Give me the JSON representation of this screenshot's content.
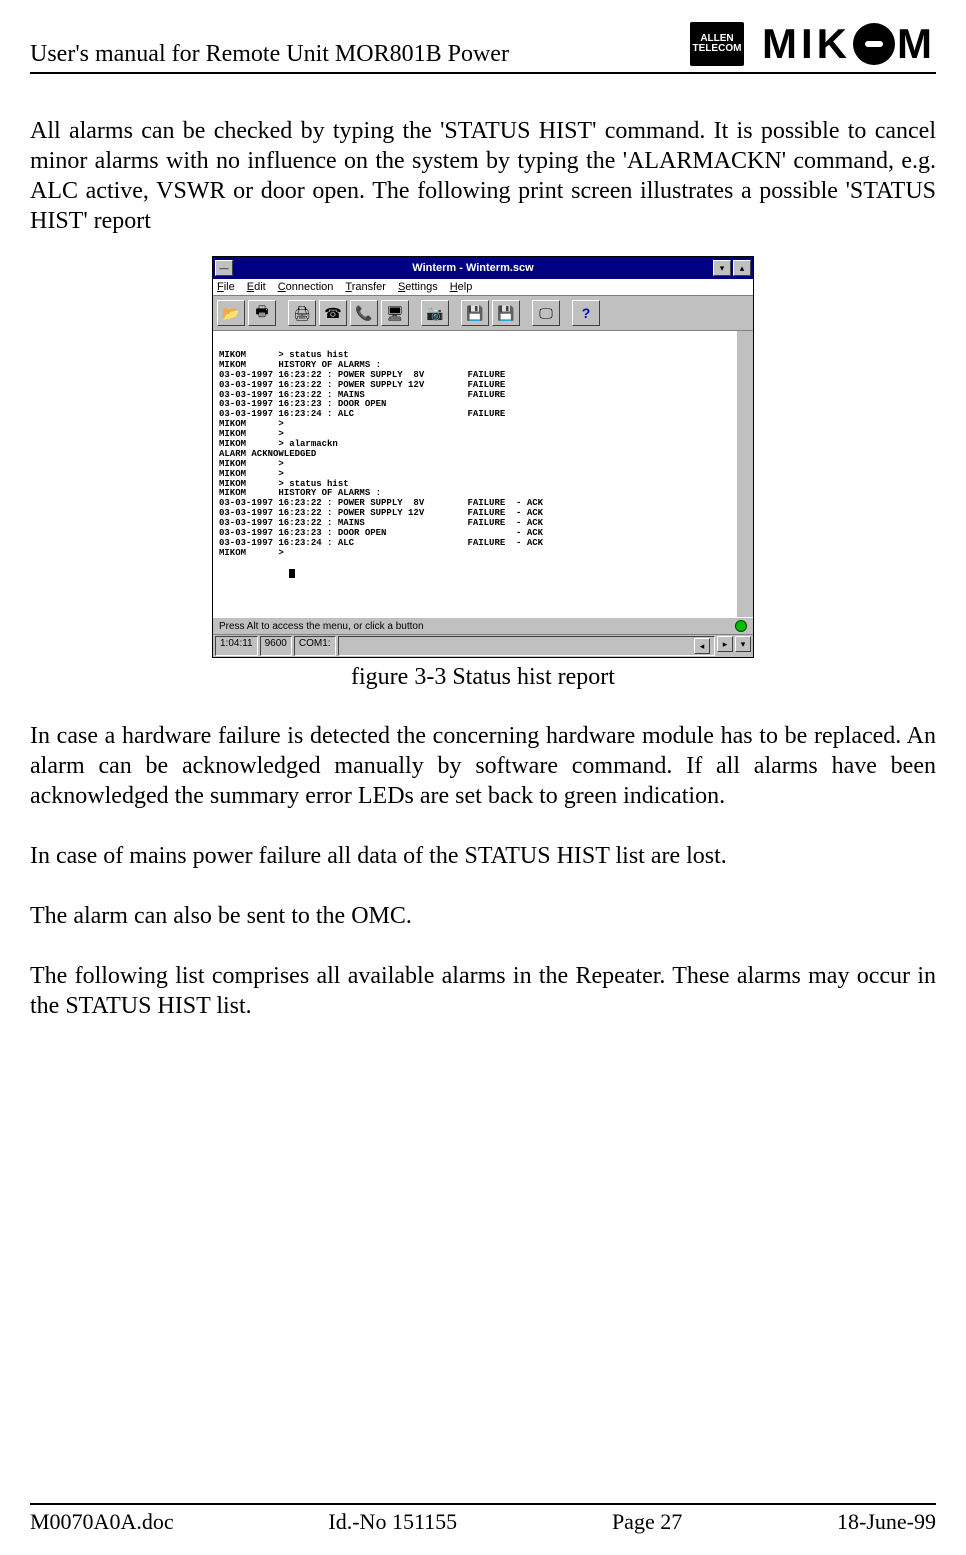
{
  "header": {
    "title": "User's manual for Remote Unit MOR801B Power",
    "logo1_line1": "ALLEN",
    "logo1_line2": "TELECOM",
    "logo2_pre": "MIK",
    "logo2_post": "M"
  },
  "body": {
    "p1": "All alarms can be checked by typing the 'STATUS HIST' command. It is possible to cancel minor alarms with no influence on the system by typing the 'ALARMACKN' command, e.g. ALC active, VSWR or door open. The following print screen illustrates a possible 'STATUS HIST' report",
    "caption": "figure 3-3 Status hist report",
    "p2": "In case a hardware failure is detected the concerning hardware module has to be replaced. An alarm can be acknowledged manually by software command. If all alarms have been acknowledged the summary error LEDs are set back to green indication.",
    "p3": "In case of mains power failure all data of the STATUS HIST list are lost.",
    "p4": "The alarm can also be sent to the OMC.",
    "p5": "The following list comprises all available alarms in the Repeater. These alarms may occur in the STATUS HIST list."
  },
  "window": {
    "title": "Winterm - Winterm.scw",
    "menu": [
      "File",
      "Edit",
      "Connection",
      "Transfer",
      "Settings",
      "Help"
    ],
    "toolbar_icons": [
      "open-icon",
      "print-icon",
      "printer2-icon",
      "phone-icon",
      "phone-down-icon",
      "modem-icon",
      "camera-icon",
      "save-icon",
      "save2-icon",
      "display-icon",
      "help-icon"
    ],
    "terminal_lines": [
      "MIKOM      > status hist",
      "MIKOM      HISTORY OF ALARMS :",
      "03-03-1997 16:23:22 : POWER SUPPLY  8V        FAILURE",
      "03-03-1997 16:23:22 : POWER SUPPLY 12V        FAILURE",
      "03-03-1997 16:23:22 : MAINS                   FAILURE",
      "03-03-1997 16:23:23 : DOOR OPEN",
      "03-03-1997 16:23:24 : ALC                     FAILURE",
      "MIKOM      >",
      "MIKOM      >",
      "MIKOM      > alarmackn",
      "ALARM ACKNOWLEDGED",
      "MIKOM      >",
      "MIKOM      >",
      "MIKOM      > status hist",
      "MIKOM      HISTORY OF ALARMS :",
      "03-03-1997 16:23:22 : POWER SUPPLY  8V        FAILURE  - ACK",
      "03-03-1997 16:23:22 : POWER SUPPLY 12V        FAILURE  - ACK",
      "03-03-1997 16:23:22 : MAINS                   FAILURE  - ACK",
      "03-03-1997 16:23:23 : DOOR OPEN                        - ACK",
      "03-03-1997 16:23:24 : ALC                     FAILURE  - ACK",
      "MIKOM      >"
    ],
    "hint": "Press Alt to access the menu, or click a button",
    "status": {
      "time": "1:04:11",
      "baud": "9600",
      "port": "COM1:"
    }
  },
  "footer": {
    "left": "M0070A0A.doc",
    "id": "Id.-No 151155",
    "page": "Page 27",
    "date": "18-June-99"
  }
}
